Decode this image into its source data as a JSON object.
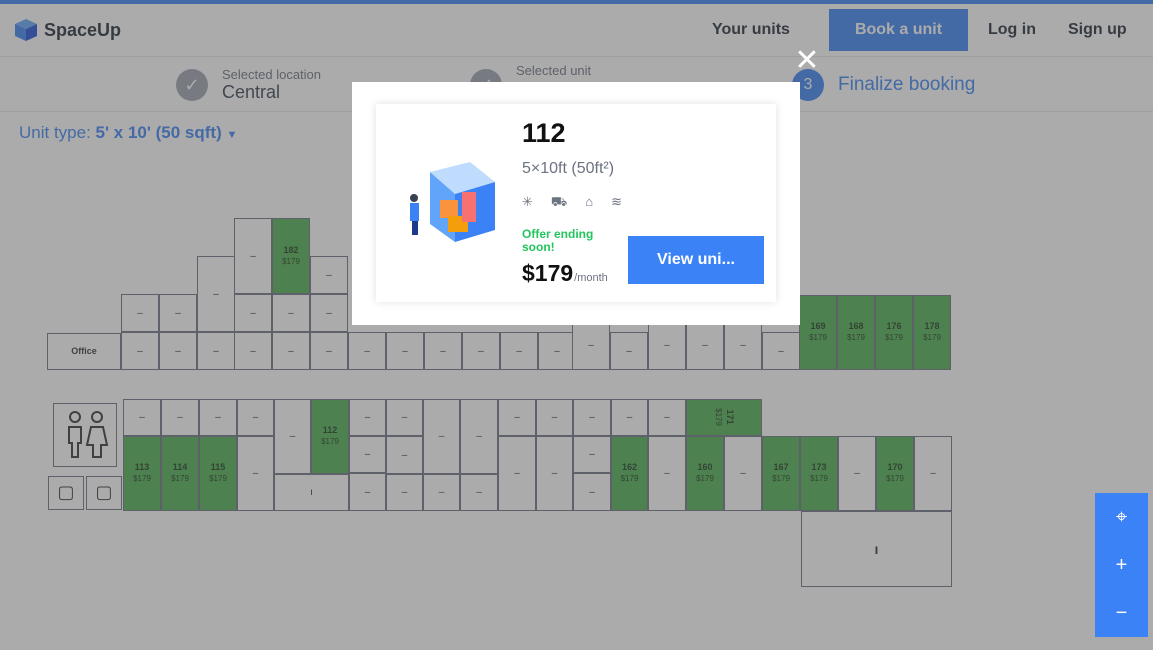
{
  "header": {
    "logo_text": "SpaceUp",
    "nav": {
      "your_units": "Your units",
      "book_unit": "Book a unit",
      "login": "Log in",
      "signup": "Sign up"
    }
  },
  "steps": {
    "location_label": "Selected location",
    "location_value": "Central",
    "unit_label": "Selected unit",
    "final_number": "3",
    "final_label": "Finalize booking"
  },
  "filter": {
    "label": "Unit type:",
    "value": "5' x 10' (50 sqft)"
  },
  "map": {
    "office_label": "Office",
    "dash": "–",
    "units": [
      {
        "num": "182",
        "price": "$179"
      },
      {
        "num": "169",
        "price": "$179"
      },
      {
        "num": "168",
        "price": "$179"
      },
      {
        "num": "176",
        "price": "$179"
      },
      {
        "num": "178",
        "price": "$179"
      },
      {
        "num": "112",
        "price": "$179"
      },
      {
        "num": "171",
        "price": "$179"
      },
      {
        "num": "113",
        "price": "$179"
      },
      {
        "num": "114",
        "price": "$179"
      },
      {
        "num": "115",
        "price": "$179"
      },
      {
        "num": "162",
        "price": "$179"
      },
      {
        "num": "160",
        "price": "$179"
      },
      {
        "num": "167",
        "price": "$179"
      },
      {
        "num": "173",
        "price": "$179"
      },
      {
        "num": "170",
        "price": "$179"
      }
    ]
  },
  "controls": {
    "locate_icon": "crosshair-icon",
    "zoom_in": "+",
    "zoom_out": "−"
  },
  "modal": {
    "unit_number": "112",
    "size": "5×10ft (50ft²)",
    "offer": "Offer ending soon!",
    "price": "$179",
    "per": "/month",
    "view_button": "View uni..."
  },
  "colors": {
    "accent": "#3b82f6",
    "available": "#4caf50",
    "offer": "#22c55e"
  }
}
